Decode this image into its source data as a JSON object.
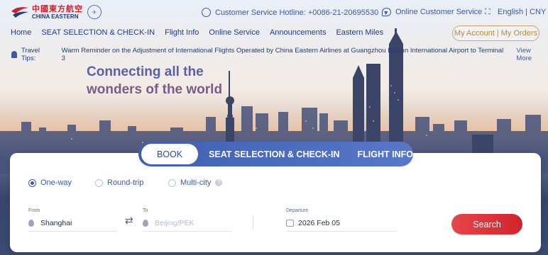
{
  "brand": {
    "name_cn": "中國東方航空",
    "name_en": "CHINA EASTERN",
    "badge": "✈"
  },
  "header": {
    "hotline": "Customer Service Hotline: +0086-21-20695530",
    "online_service": "Online Customer Service",
    "lang": "English | CNY"
  },
  "nav": {
    "items": [
      "Home",
      "SEAT SELECTION & CHECK-IN",
      "Flight Info",
      "Online Service",
      "Announcements",
      "Eastern Miles"
    ],
    "account": "My Account | My Orders"
  },
  "tips": {
    "label": "Travel Tips:",
    "text": "Warm Reminder on the Adjustment of International Flights Operated by China Eastern Airlines at Guangzhou Baiyun  International Airport to Terminal 3",
    "more": "View More"
  },
  "slogan": {
    "line1": "Connecting all the",
    "line2": "wonders of the world"
  },
  "booking": {
    "tabs": [
      "BOOK",
      "SEAT SELECTION & CHECK-IN",
      "FLIGHT INFO"
    ],
    "trip_types": [
      "One-way",
      "Round-trip",
      "Multi-city"
    ],
    "selected_trip": "One-way",
    "from_label": "From",
    "from_value": "Shanghai",
    "to_label": "To",
    "to_placeholder": "Beijing/PEK",
    "departure_label": "Departure",
    "departure_value": "2026 Feb 05",
    "search_label": "Search"
  },
  "colors": {
    "brand_red": "#d0202e",
    "brand_blue": "#1f3b8a",
    "search": "#e0353b"
  }
}
